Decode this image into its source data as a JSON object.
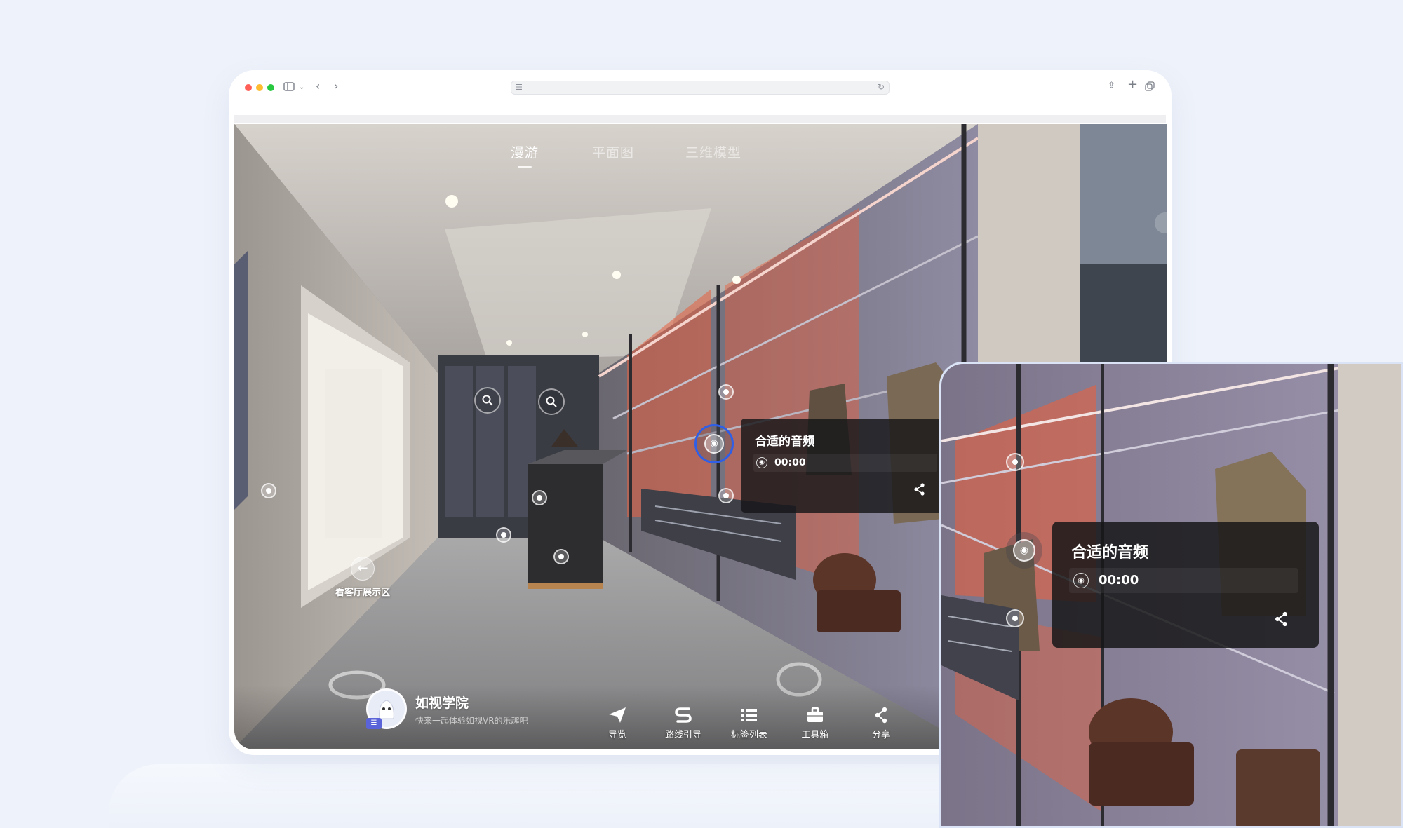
{
  "view_tabs": [
    "漫游",
    "平面图",
    "三维模型"
  ],
  "hotspot": {
    "back_label": "看客厅展示区"
  },
  "audio_card": {
    "title": "合适的音频",
    "time": "00:00"
  },
  "brand": {
    "name": "如视学院",
    "slogan": "快来一起体验如视VR的乐趣吧"
  },
  "bottom_nav": [
    {
      "label": "导览",
      "icon": "paper-plane-icon"
    },
    {
      "label": "路线引导",
      "icon": "route-icon"
    },
    {
      "label": "标签列表",
      "icon": "list-icon"
    },
    {
      "label": "工具箱",
      "icon": "toolbox-icon"
    },
    {
      "label": "分享",
      "icon": "share-icon"
    }
  ],
  "colors": {
    "page_bg": "#eef2fa",
    "accent_ring": "#2f5fe6",
    "card_bg": "#161618"
  }
}
